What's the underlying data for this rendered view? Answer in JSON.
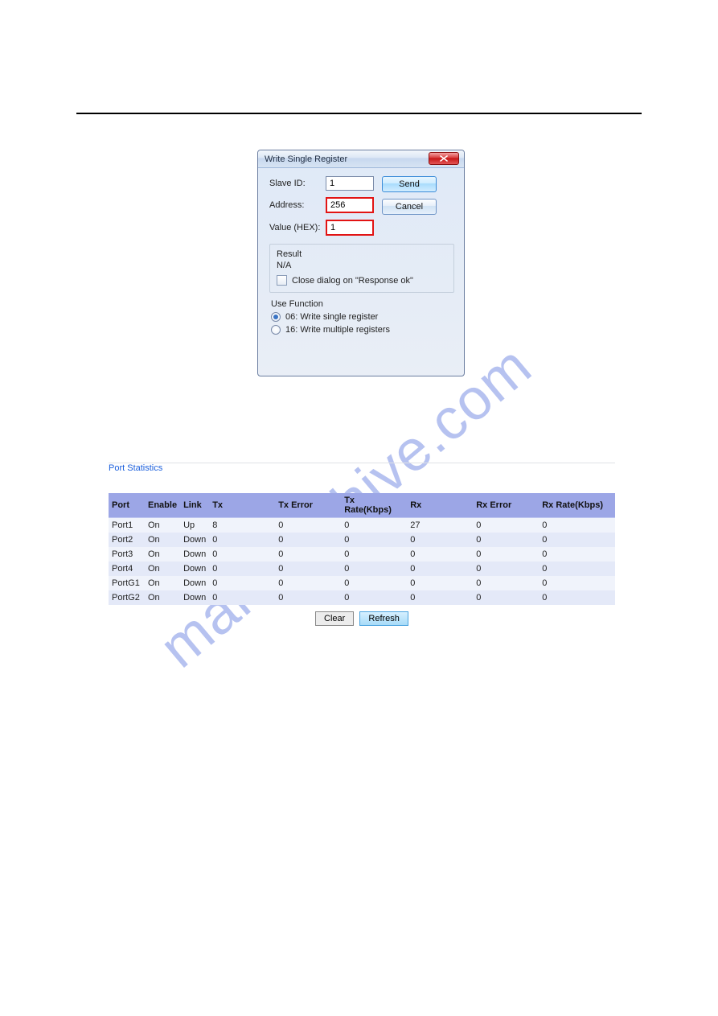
{
  "watermark": "manualshive.com",
  "dialog": {
    "title": "Write Single Register",
    "labels": {
      "slave_id": "Slave ID:",
      "address": "Address:",
      "value_hex": "Value (HEX):"
    },
    "fields": {
      "slave_id": "1",
      "address": "256",
      "value_hex": "1"
    },
    "buttons": {
      "send": "Send",
      "cancel": "Cancel"
    },
    "result": {
      "legend": "Result",
      "value": "N/A",
      "close_on_ok": "Close dialog on \"Response ok\""
    },
    "use_function": {
      "title": "Use Function",
      "opts": [
        "06: Write single register",
        "16: Write multiple registers"
      ],
      "selected_index": 0
    }
  },
  "stats": {
    "title": "Port Statistics",
    "headers": [
      "Port",
      "Enable",
      "Link",
      "Tx",
      "Tx Error",
      "Tx Rate(Kbps)",
      "Rx",
      "Rx Error",
      "Rx Rate(Kbps)"
    ],
    "rows": [
      {
        "port": "Port1",
        "enable": "On",
        "link": "Up",
        "tx": "8",
        "txerr": "0",
        "txrate": "0",
        "rx": "27",
        "rxerr": "0",
        "rxrate": "0"
      },
      {
        "port": "Port2",
        "enable": "On",
        "link": "Down",
        "tx": "0",
        "txerr": "0",
        "txrate": "0",
        "rx": "0",
        "rxerr": "0",
        "rxrate": "0"
      },
      {
        "port": "Port3",
        "enable": "On",
        "link": "Down",
        "tx": "0",
        "txerr": "0",
        "txrate": "0",
        "rx": "0",
        "rxerr": "0",
        "rxrate": "0"
      },
      {
        "port": "Port4",
        "enable": "On",
        "link": "Down",
        "tx": "0",
        "txerr": "0",
        "txrate": "0",
        "rx": "0",
        "rxerr": "0",
        "rxrate": "0"
      },
      {
        "port": "PortG1",
        "enable": "On",
        "link": "Down",
        "tx": "0",
        "txerr": "0",
        "txrate": "0",
        "rx": "0",
        "rxerr": "0",
        "rxrate": "0"
      },
      {
        "port": "PortG2",
        "enable": "On",
        "link": "Down",
        "tx": "0",
        "txerr": "0",
        "txrate": "0",
        "rx": "0",
        "rxerr": "0",
        "rxrate": "0"
      }
    ],
    "buttons": {
      "clear": "Clear",
      "refresh": "Refresh"
    }
  }
}
